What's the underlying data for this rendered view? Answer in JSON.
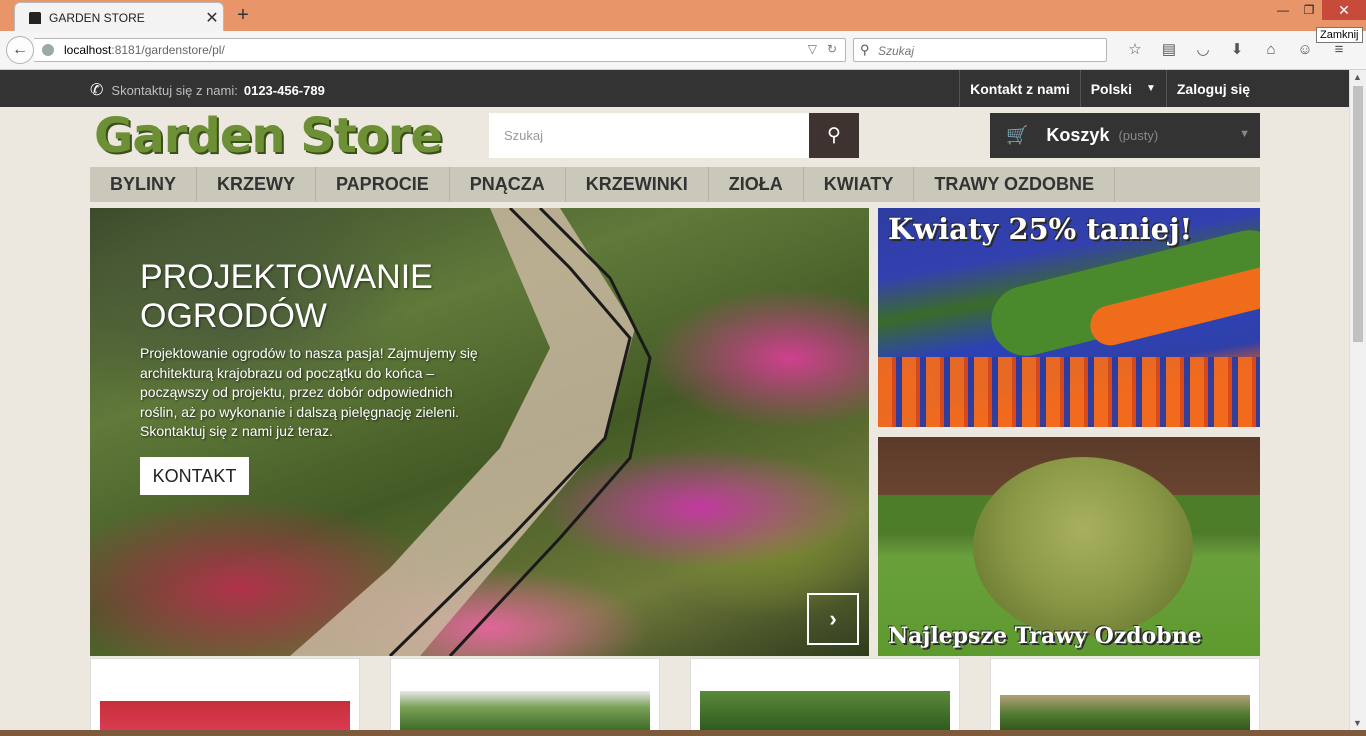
{
  "browser": {
    "tab_title": "GARDEN STORE",
    "url_host": "localhost",
    "url_path": ":8181/gardenstore/pl/",
    "search_placeholder": "Szukaj",
    "tooltip": "Zamknij",
    "icons": [
      "back-icon",
      "reload-icon",
      "bookmark-star-icon",
      "reading-list-icon",
      "pocket-icon",
      "download-icon",
      "home-icon",
      "chat-icon",
      "menu-icon"
    ]
  },
  "topbar": {
    "contact_label": "Skontaktuj się z nami:",
    "phone": "0123-456-789",
    "links": {
      "contact": "Kontakt z nami",
      "language": "Polski",
      "login": "Zaloguj się"
    }
  },
  "header": {
    "logo": "Garden Store",
    "search_placeholder": "Szukaj",
    "cart_label": "Koszyk",
    "cart_status": "(pusty)"
  },
  "menu": [
    "BYLINY",
    "KRZEWY",
    "PAPROCIE",
    "PNĄCZA",
    "KRZEWINKI",
    "ZIOŁA",
    "KWIATY",
    "TRAWY OZDOBNE"
  ],
  "hero": {
    "title": "PROJEKTOWANIE OGRODÓW",
    "text": "Projektowanie ogrodów to nasza pasja! Zajmujemy się architekturą krajobrazu od początku do końca – począwszy od projektu, przez dobór odpowiednich roślin, aż po wykonanie i dalszą pielęgnację zieleni. Skontaktuj się z nami już teraz.",
    "button": "KONTAKT"
  },
  "banners": {
    "top": "Kwiaty 25% taniej!",
    "bottom": "Najlepsze Trawy Ozdobne"
  },
  "colors": {
    "accent_green": "#6d8f35",
    "topbar": "#333333",
    "menu_bg": "#c9c8bb",
    "search_btn": "#3f3331"
  }
}
